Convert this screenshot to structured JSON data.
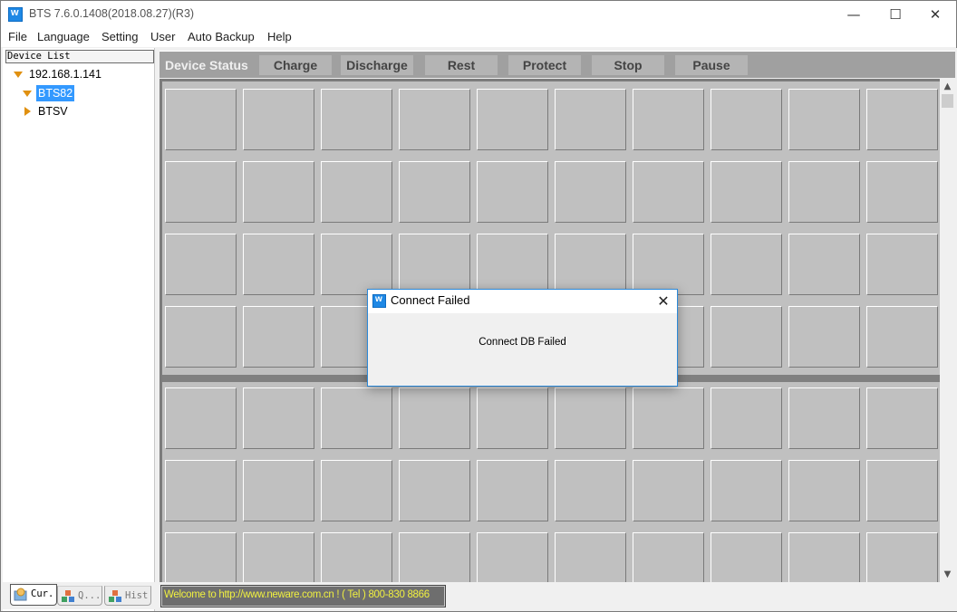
{
  "window": {
    "title": "BTS 7.6.0.1408(2018.08.27)(R3)",
    "controls": {
      "minimize": "—",
      "maximize": "☐",
      "close": "✕"
    }
  },
  "menu": [
    "File",
    "Language",
    "Setting",
    "User",
    "Auto Backup",
    "Help"
  ],
  "device_list": {
    "header": "Device List",
    "tree": [
      {
        "label": "192.168.1.141",
        "expanded": true,
        "level": 0
      },
      {
        "label": "BTS82",
        "expanded": true,
        "level": 1,
        "selected": true
      },
      {
        "label": "BTSV",
        "expanded": false,
        "level": 1
      }
    ]
  },
  "left_tabs": [
    {
      "label": "Cur.",
      "icon": "current-icon",
      "active": true
    },
    {
      "label": "Q...",
      "icon": "query-icon",
      "active": false
    },
    {
      "label": "Hist",
      "icon": "history-icon",
      "active": false
    }
  ],
  "toolbar": {
    "title": "Device Status",
    "buttons": [
      "Charge",
      "Discharge",
      "Rest",
      "Protect",
      "Stop",
      "Pause"
    ]
  },
  "channel_grid": {
    "columns": 10,
    "top_rows": 4,
    "bottom_rows_visible": 3
  },
  "status_bar": {
    "text": "Welcome to http://www.neware.com.cn !    ( Tel ) 800-830 8866"
  },
  "dialog": {
    "title": "Connect Failed",
    "message": "Connect DB Failed",
    "close": "✕"
  },
  "colors": {
    "accent": "#3399ff",
    "tree_triangle": "#e09010",
    "status_text": "#f0f040",
    "toolbar_bg": "#a0a0a0",
    "tile_bg": "#c0c0c0"
  }
}
